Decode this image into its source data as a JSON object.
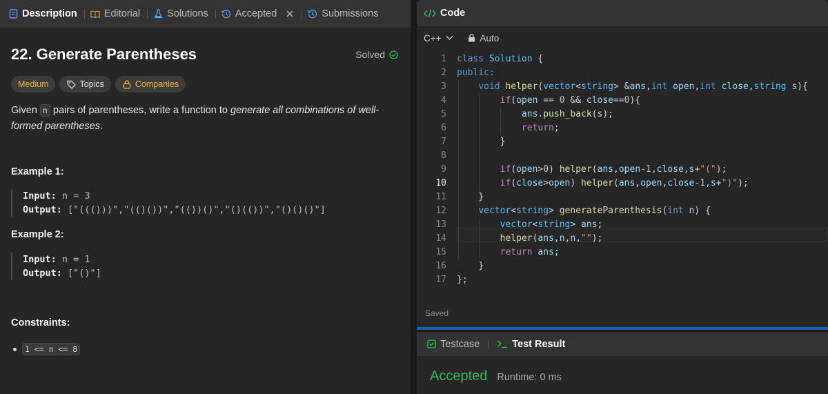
{
  "left_tabs": [
    {
      "label": "Description",
      "icon": "description-icon"
    },
    {
      "label": "Editorial",
      "icon": "book-icon"
    },
    {
      "label": "Solutions",
      "icon": "flask-icon"
    },
    {
      "label": "Accepted",
      "icon": "history-icon"
    },
    {
      "label": "Submissions",
      "icon": "history-icon"
    }
  ],
  "problem": {
    "title": "22. Generate Parentheses",
    "status": "Solved",
    "tags": {
      "difficulty": "Medium",
      "topics": "Topics",
      "companies": "Companies"
    },
    "desc_pre": "Given ",
    "desc_code": "n",
    "desc_mid": " pairs of parentheses, write a function to ",
    "desc_em": "generate all combinations of well-formed parentheses",
    "desc_end": "."
  },
  "examples": [
    {
      "title": "Example 1:",
      "input_label": "Input:",
      "input_value": " n = 3",
      "output_label": "Output:",
      "output_value": " [\"((()))\",\"(()())\",\"(())()\",\"()(())\",\"()()()\"]"
    },
    {
      "title": "Example 2:",
      "input_label": "Input:",
      "input_value": " n = 1",
      "output_label": "Output:",
      "output_value": " [\"()\"]"
    }
  ],
  "constraints": {
    "title": "Constraints:",
    "items": [
      "1 <= n <= 8"
    ]
  },
  "code_panel": {
    "title": "Code",
    "language": "C++",
    "mode": "Auto",
    "status": "Saved",
    "current_line": 10
  },
  "code_lines": [
    "class Solution {",
    "public:",
    "    void helper(vector<string> &ans,int open,int close,string s){",
    "        if(open == 0 && close==0){",
    "            ans.push_back(s);",
    "            return;",
    "        }",
    "",
    "        if(open>0) helper(ans,open-1,close,s+\"(\");",
    "        if(close>open) helper(ans,open,close-1,s+\")\");",
    "    }",
    "    vector<string> generateParenthesis(int n) {",
    "        vector<string> ans;",
    "        helper(ans,n,n,\"\");",
    "        return ans;",
    "    }",
    "};"
  ],
  "result_panel": {
    "tabs": [
      {
        "label": "Testcase"
      },
      {
        "label": "Test Result"
      }
    ],
    "verdict": "Accepted",
    "runtime": "Runtime: 0 ms"
  },
  "colors": {
    "accent_green": "#2cbb5d",
    "medium_yellow": "#f5b72f",
    "divider_blue": "#1a5fb4"
  }
}
